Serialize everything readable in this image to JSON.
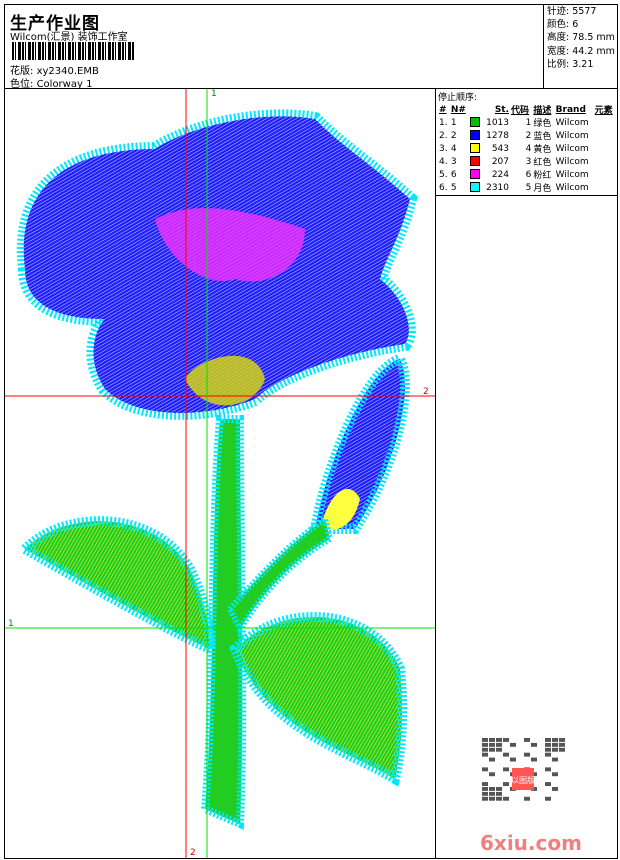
{
  "header": {
    "title": "生产作业图",
    "company": "Wilcom(汇景) 装饰工作室",
    "design_label": "花版:",
    "design_value": "xy2340.EMB",
    "colorway_label": "色位:",
    "colorway_value": "Colorway 1"
  },
  "stats": [
    {
      "label": "针迹:",
      "value": "5577"
    },
    {
      "label": "颜色:",
      "value": "6"
    },
    {
      "label": "高度:",
      "value": "78.5 mm"
    },
    {
      "label": "宽度:",
      "value": "44.2 mm"
    },
    {
      "label": "比例:",
      "value": "3.21"
    }
  ],
  "sequence": {
    "title": "停止顺序:",
    "columns": [
      "#",
      "N#",
      "St.",
      "代码",
      "描述",
      "Brand",
      "元素"
    ],
    "rows": [
      {
        "num": "1.",
        "n": "1",
        "color": "#00c000",
        "st": "1013",
        "code": "1",
        "desc": "绿色",
        "brand": "Wilcom"
      },
      {
        "num": "2.",
        "n": "2",
        "color": "#0000ff",
        "st": "1278",
        "code": "2",
        "desc": "蓝色",
        "brand": "Wilcom"
      },
      {
        "num": "3.",
        "n": "4",
        "color": "#ffff00",
        "st": "543",
        "code": "4",
        "desc": "黄色",
        "brand": "Wilcom"
      },
      {
        "num": "4.",
        "n": "3",
        "color": "#ff0000",
        "st": "207",
        "code": "3",
        "desc": "红色",
        "brand": "Wilcom"
      },
      {
        "num": "5.",
        "n": "6",
        "color": "#ff00ff",
        "st": "224",
        "code": "6",
        "desc": "粉红",
        "brand": "Wilcom"
      },
      {
        "num": "6.",
        "n": "5",
        "color": "#00ffff",
        "st": "2310",
        "code": "5",
        "desc": "月色",
        "brand": "Wilcom"
      }
    ]
  },
  "guides": {
    "top": "1",
    "right": "2",
    "left": "1",
    "bottom": "2"
  },
  "watermark": {
    "text": "6xiu.com",
    "seal": "以图版"
  }
}
